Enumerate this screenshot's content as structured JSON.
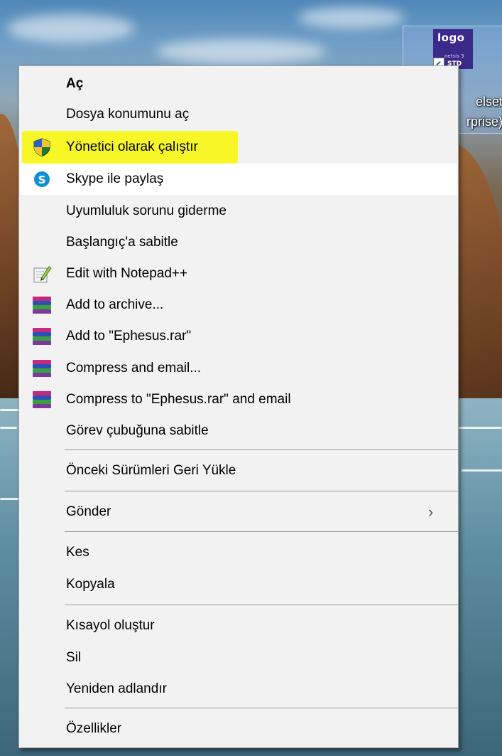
{
  "desktop": {
    "icon": {
      "logo_text": "logo",
      "small_text": "netsis 3",
      "badge_text": "STD",
      "label_line1": "elset",
      "label_line2": "rprise)"
    }
  },
  "context_menu": {
    "items": [
      {
        "label": "Aç",
        "bold": true,
        "icon": null
      },
      {
        "label": "Dosya konumunu aç",
        "icon": null
      },
      {
        "label": "Yönetici olarak çalıştır",
        "icon": "uac-shield-icon",
        "highlighted": true
      },
      {
        "label": "Skype ile paylaş",
        "icon": "skype-icon",
        "hovered": true
      },
      {
        "label": "Uyumluluk sorunu giderme",
        "icon": null
      },
      {
        "label": "Başlangıç'a sabitle",
        "icon": null
      },
      {
        "label": "Edit with Notepad++",
        "icon": "notepad-plus-plus-icon"
      },
      {
        "label": "Add to archive...",
        "icon": "winrar-icon"
      },
      {
        "label": "Add to \"Ephesus.rar\"",
        "icon": "winrar-icon"
      },
      {
        "label": "Compress and email...",
        "icon": "winrar-icon"
      },
      {
        "label": "Compress to \"Ephesus.rar\" and email",
        "icon": "winrar-icon"
      },
      {
        "label": "Görev çubuğuna sabitle",
        "icon": null
      },
      {
        "label": "Önceki Sürümleri Geri Yükle",
        "icon": null
      },
      {
        "label": "Gönder",
        "icon": null,
        "submenu": true
      },
      {
        "label": "Kes",
        "icon": null
      },
      {
        "label": "Kopyala",
        "icon": null
      },
      {
        "label": "Kısayol oluştur",
        "icon": null
      },
      {
        "label": "Sil",
        "icon": null
      },
      {
        "label": "Yeniden adlandır",
        "icon": null
      },
      {
        "label": "Özellikler",
        "icon": null
      }
    ],
    "submenu_arrow": "›"
  },
  "colors": {
    "menu_bg": "#f2f2f2",
    "hover_bg": "#ffffff",
    "highlight": "#f7f728",
    "separator": "#9a9a9a"
  }
}
